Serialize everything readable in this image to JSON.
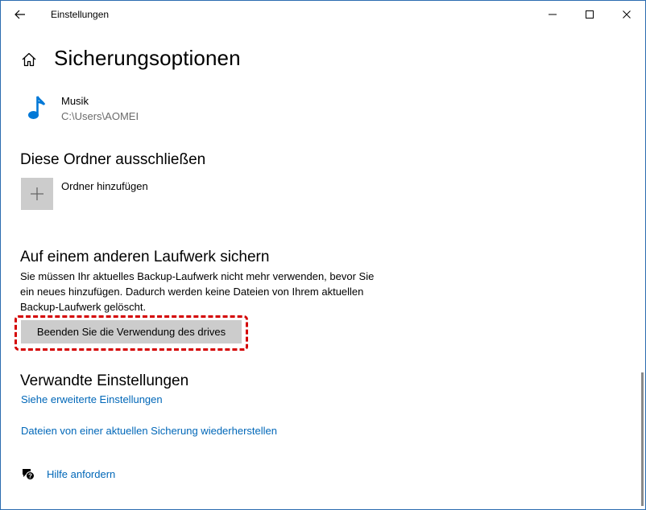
{
  "window": {
    "title": "Einstellungen",
    "controls": {
      "minimize": "minimize-icon",
      "maximize": "maximize-icon",
      "close": "close-icon"
    }
  },
  "header": {
    "title": "Sicherungsoptionen",
    "home_icon": "home-icon"
  },
  "included_folders": [
    {
      "name": "Musik",
      "path": "C:\\Users\\AOMEI",
      "icon": "music-note-icon",
      "icon_color": "#0078d7"
    }
  ],
  "exclude_section": {
    "heading": "Diese Ordner ausschließen",
    "add_label": "Ordner hinzufügen"
  },
  "other_drive_section": {
    "heading": "Auf einem anderen Laufwerk sichern",
    "description": "Sie müssen Ihr aktuelles Backup-Laufwerk nicht mehr verwenden, bevor Sie ein neues hinzufügen. Dadurch werden keine Dateien von Ihrem aktuellen Backup-Laufwerk gelöscht.",
    "stop_button_label": "Beenden Sie die Verwendung des drives",
    "highlight_color": "#d40000"
  },
  "related_section": {
    "heading": "Verwandte Einstellungen",
    "links": [
      "Siehe erweiterte Einstellungen",
      "Dateien von einer aktuellen Sicherung wiederherstellen"
    ]
  },
  "help": {
    "label": "Hilfe anfordern",
    "icon": "help-chat-icon"
  },
  "colors": {
    "link": "#0067b8",
    "accent": "#0078d7",
    "button_bg": "#cccccc"
  }
}
